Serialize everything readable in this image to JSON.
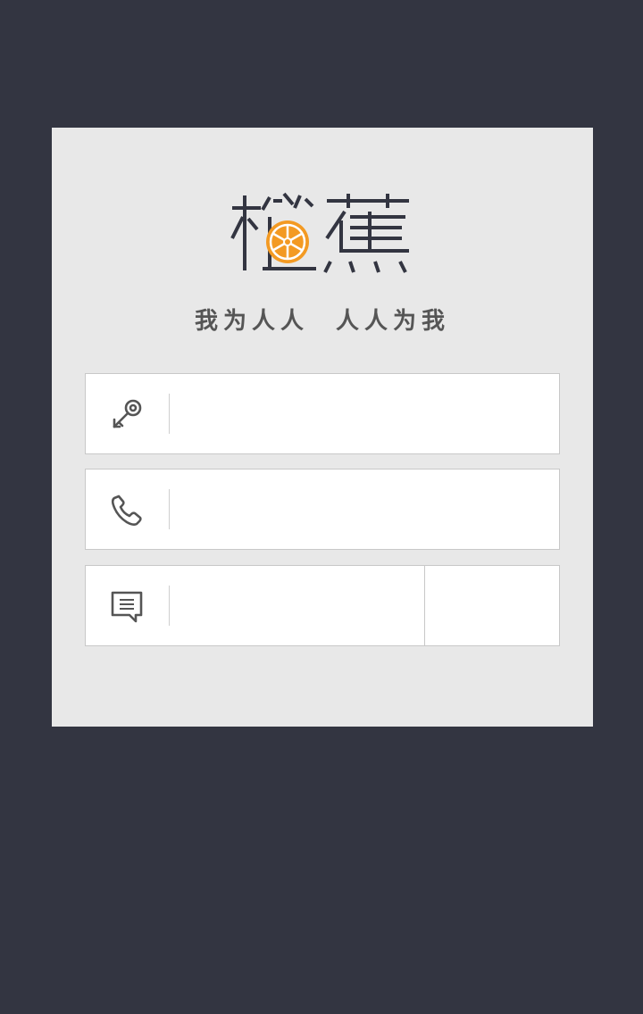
{
  "brand": {
    "name": "橙蕉",
    "slogan": "我为人人  人人为我",
    "accent_color": "#f39a23",
    "text_color": "#333541"
  },
  "form": {
    "fields": [
      {
        "icon": "key-icon",
        "value": "",
        "placeholder": ""
      },
      {
        "icon": "phone-icon",
        "value": "",
        "placeholder": ""
      },
      {
        "icon": "message-icon",
        "value": "",
        "placeholder": ""
      }
    ],
    "code_button_label": ""
  },
  "colors": {
    "background": "#333541",
    "card": "#e8e8e8",
    "field": "#ffffff",
    "border": "#c8c8c8"
  }
}
